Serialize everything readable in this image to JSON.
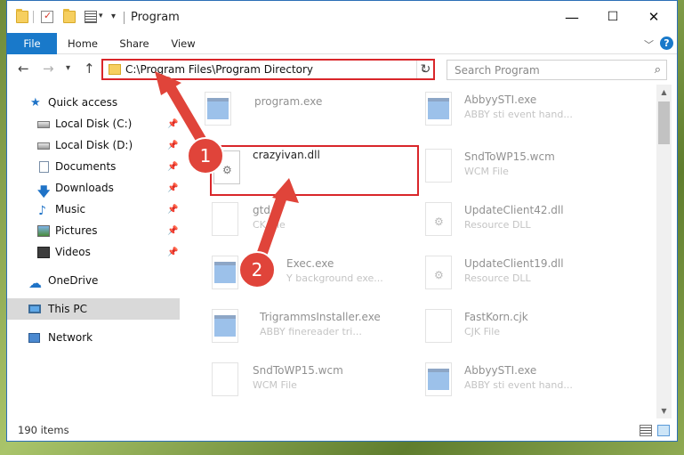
{
  "window": {
    "title": "Program",
    "controls": {
      "minimize": "—",
      "maximize": "☐",
      "close": "✕"
    }
  },
  "ribbon": {
    "tabs": [
      "File",
      "Home",
      "Share",
      "View"
    ],
    "help": "?"
  },
  "nav": {
    "address": "C:\\Program Files\\Program Directory",
    "search_placeholder": "Search Program"
  },
  "sidebar": {
    "items": [
      {
        "label": "Quick access",
        "icon": "star-icon",
        "pinned": false
      },
      {
        "label": "Local Disk (C:)",
        "icon": "disk-icon",
        "pinned": true
      },
      {
        "label": "Local Disk (D:)",
        "icon": "disk-icon",
        "pinned": true
      },
      {
        "label": "Documents",
        "icon": "documents-icon",
        "pinned": true
      },
      {
        "label": "Downloads",
        "icon": "downloads-icon",
        "pinned": true
      },
      {
        "label": "Music",
        "icon": "music-icon",
        "pinned": true
      },
      {
        "label": "Pictures",
        "icon": "pictures-icon",
        "pinned": true
      },
      {
        "label": "Videos",
        "icon": "videos-icon",
        "pinned": true
      },
      {
        "label": "OneDrive",
        "icon": "onedrive-icon",
        "pinned": false
      },
      {
        "label": "This PC",
        "icon": "pc-icon",
        "pinned": false,
        "selected": true
      },
      {
        "label": "Network",
        "icon": "network-icon",
        "pinned": false
      }
    ]
  },
  "files": [
    {
      "name": "program.exe",
      "type": "",
      "icon": "exe"
    },
    {
      "name": "AbbyySTI.exe",
      "type": "ABBY sti event hand...",
      "icon": "exe"
    },
    {
      "name": "crazyivan.dll",
      "type": "",
      "icon": "dll",
      "highlighted": true
    },
    {
      "name": "SndToWP15.wcm",
      "type": "WCM File",
      "icon": "doc"
    },
    {
      "name": "gtd",
      "type": "CK File",
      "icon": "doc"
    },
    {
      "name": "UpdateClient42.dll",
      "type": "Resource DLL",
      "icon": "dll"
    },
    {
      "name": "Exec.exe",
      "type": "Y background exe...",
      "icon": "exe"
    },
    {
      "name": "UpdateClient19.dll",
      "type": "Resource DLL",
      "icon": "dll"
    },
    {
      "name": "TrigrammsInstaller.exe",
      "type": "ABBY finereader tri...",
      "icon": "exe"
    },
    {
      "name": "FastKorn.cjk",
      "type": "CJK File",
      "icon": "doc"
    },
    {
      "name": "SndToWP15.wcm",
      "type": "WCM File",
      "icon": "doc"
    },
    {
      "name": "AbbyySTI.exe",
      "type": "ABBY sti event hand...",
      "icon": "exe"
    }
  ],
  "status": {
    "items_count": "190 items"
  },
  "callouts": [
    "1",
    "2"
  ],
  "colors": {
    "accent": "#1979ca",
    "highlight": "#d9262a",
    "arrow": "#e0443a"
  }
}
